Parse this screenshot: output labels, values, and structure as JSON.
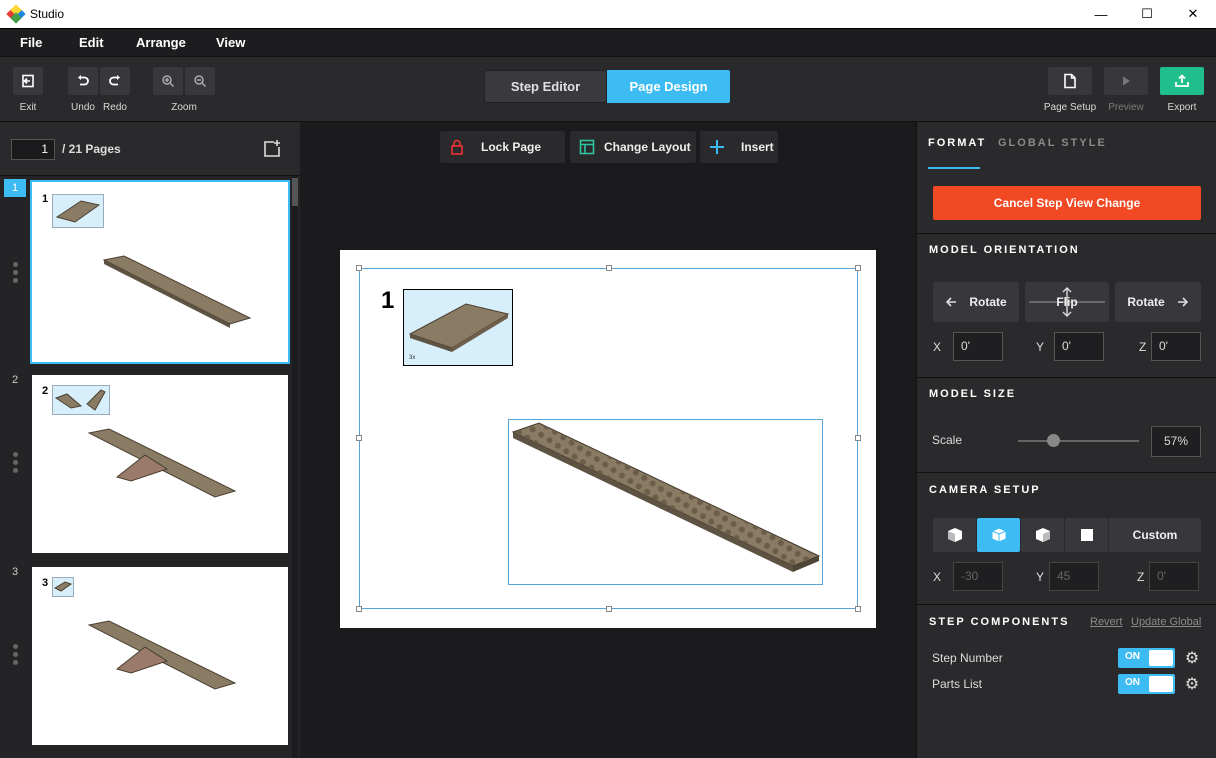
{
  "window": {
    "title": "Studio",
    "minimize": "—",
    "maximize": "☐",
    "close": "✕"
  },
  "menu": [
    "File",
    "Edit",
    "Arrange",
    "View"
  ],
  "toolbar": {
    "exit": "Exit",
    "undo": "Undo",
    "redo": "Redo",
    "zoom": "Zoom",
    "mode_step": "Step Editor",
    "mode_page": "Page Design",
    "page_setup": "Page Setup",
    "preview": "Preview",
    "export": "Export"
  },
  "pages": {
    "current": "1",
    "total_label": "/ 21 Pages",
    "thumbs": [
      {
        "num": "1",
        "step": "1"
      },
      {
        "num": "2",
        "step": "2"
      },
      {
        "num": "3",
        "step": "3"
      }
    ]
  },
  "canvas": {
    "lock_page": "Lock Page",
    "change_layout": "Change Layout",
    "insert": "Insert",
    "step_number": "1",
    "parts_qty": "3x"
  },
  "panel": {
    "tab_format": "FORMAT",
    "tab_global": "GLOBAL STYLE",
    "cancel_step_view": "Cancel Step View Change",
    "model_orientation": "MODEL ORIENTATION",
    "rotate_left": "Rotate",
    "flip": "Flip",
    "rotate_right": "Rotate",
    "orient": {
      "x_label": "X",
      "x": "0'",
      "y_label": "Y",
      "y": "0'",
      "z_label": "Z",
      "z": "0'"
    },
    "model_size": "MODEL SIZE",
    "scale_label": "Scale",
    "scale_value": "57%",
    "scale_fraction": 0.29,
    "camera_setup": "CAMERA SETUP",
    "custom": "Custom",
    "camera": {
      "x_label": "X",
      "x": "-30",
      "y_label": "Y",
      "y": "45",
      "z_label": "Z",
      "z": "0'"
    },
    "step_components": "STEP COMPONENTS",
    "revert": "Revert",
    "update_global": "Update Global",
    "components": [
      {
        "label": "Step Number",
        "state": "ON"
      },
      {
        "label": "Parts List",
        "state": "ON"
      }
    ]
  },
  "colors": {
    "accent": "#3cbcf3",
    "danger": "#f04923",
    "export": "#1fbe8a",
    "plate": "#8a7b65"
  }
}
